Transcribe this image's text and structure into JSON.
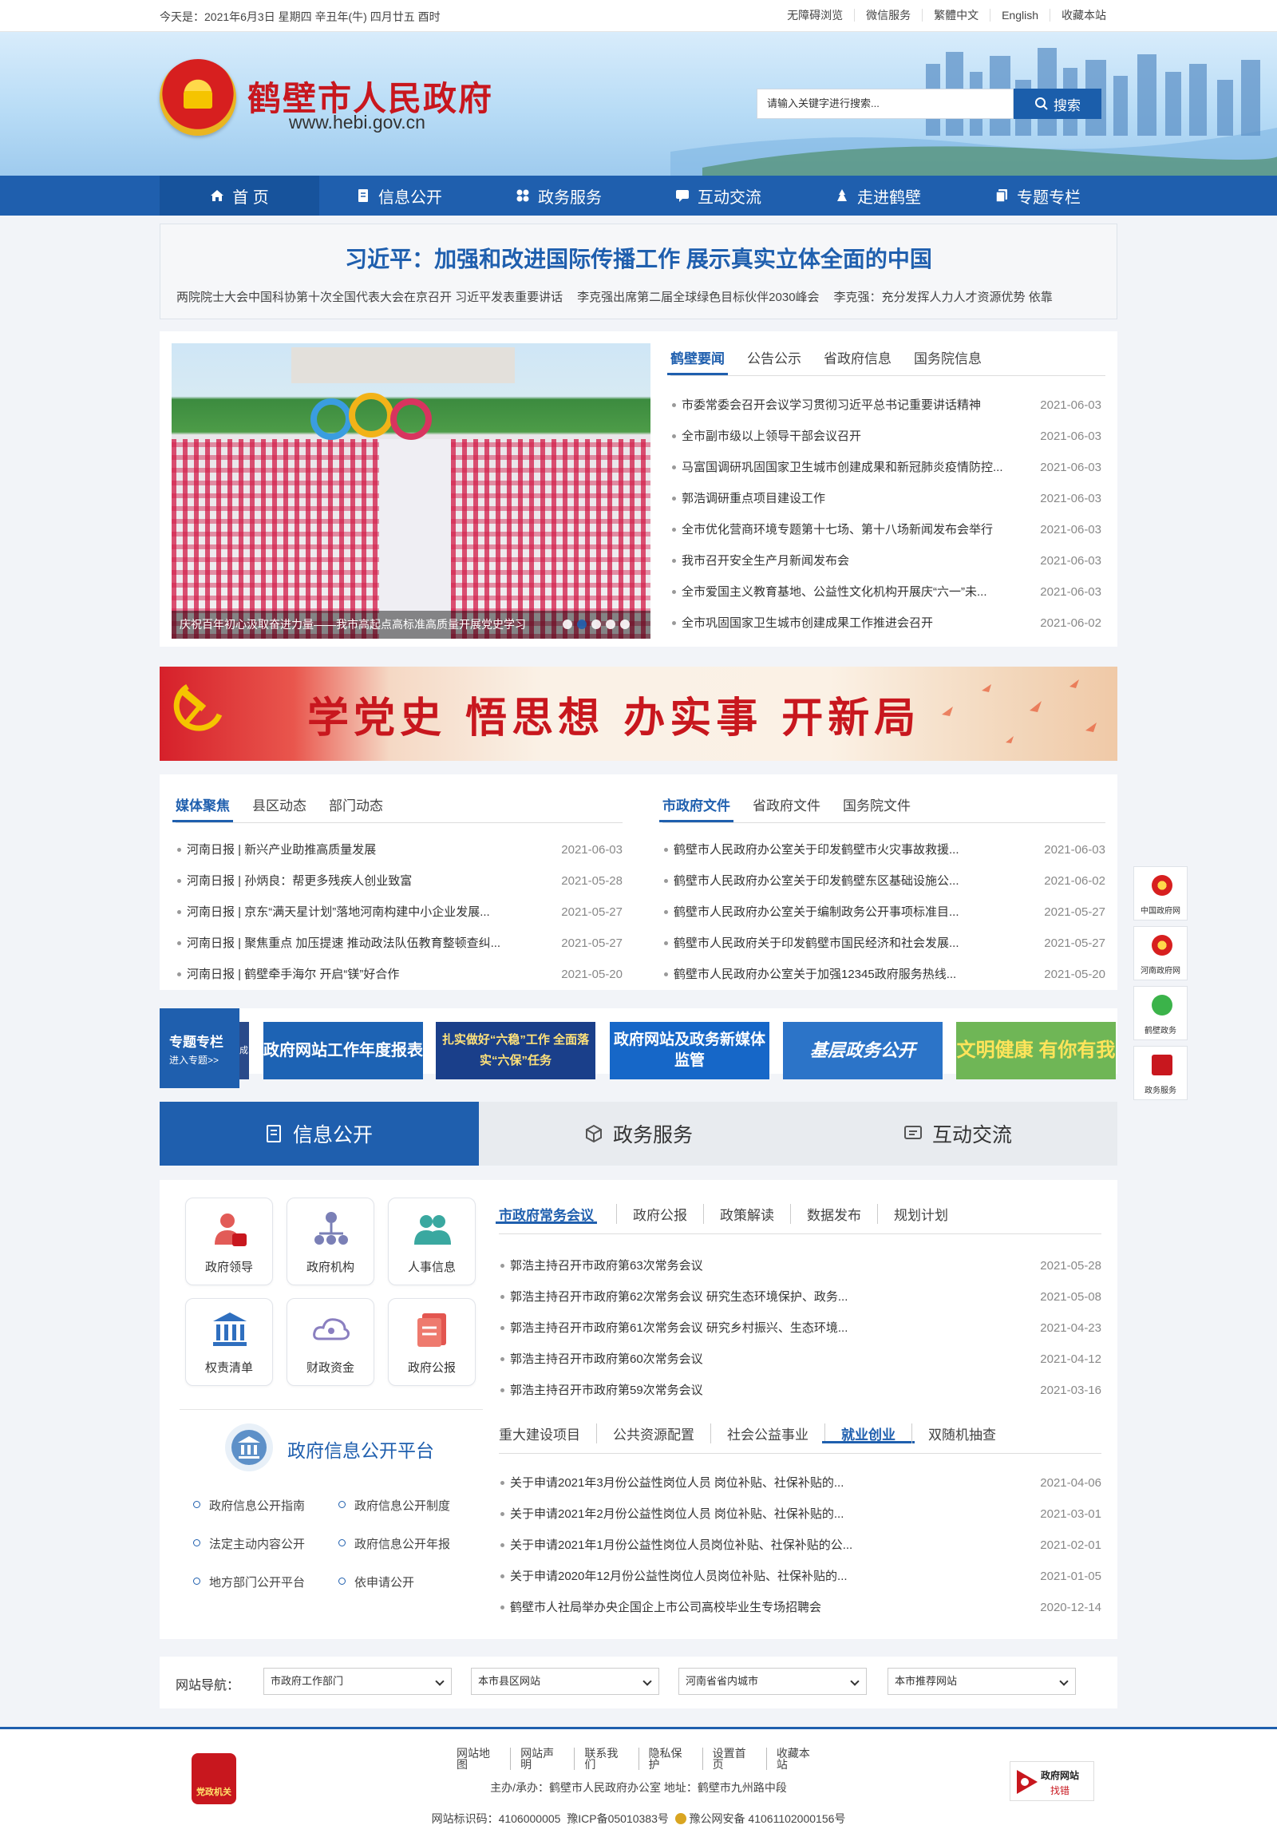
{
  "topbar": {
    "date": "今天是：2021年6月3日 星期四 辛丑年(牛) 四月廿五 酉时",
    "links": [
      "无障碍浏览",
      "微信服务",
      "繁體中文",
      "English",
      "收藏本站"
    ]
  },
  "header": {
    "title": "鹤壁市人民政府",
    "url": "www.hebi.gov.cn",
    "search_placeholder": "请输入关键字进行搜索...",
    "search_button": "搜索"
  },
  "nav": [
    "首 页",
    "信息公开",
    "政务服务",
    "互动交流",
    "走进鹤壁",
    "专题专栏"
  ],
  "headline": {
    "title": "习近平：加强和改进国际传播工作 展示真实立体全面的中国",
    "subs": [
      "两院院士大会中国科协第十次全国代表大会在京召开 习近平发表重要讲话",
      "李克强出席第二届全球绿色目标伙伴2030峰会",
      "李克强：充分发挥人力人才资源优势 依靠"
    ]
  },
  "slide": {
    "caption": "庆祝百年初心汲取奋进力量——我市高起点高标准高质量开展党史学习"
  },
  "news": {
    "tabs": [
      "鹤壁要闻",
      "公告公示",
      "省政府信息",
      "国务院信息"
    ],
    "items": [
      {
        "title": "市委常委会召开会议学习贯彻习近平总书记重要讲话精神",
        "date": "2021-06-03"
      },
      {
        "title": "全市副市级以上领导干部会议召开",
        "date": "2021-06-03"
      },
      {
        "title": "马富国调研巩固国家卫生城市创建成果和新冠肺炎疫情防控...",
        "date": "2021-06-03"
      },
      {
        "title": "郭浩调研重点项目建设工作",
        "date": "2021-06-03"
      },
      {
        "title": "全市优化营商环境专题第十七场、第十八场新闻发布会举行",
        "date": "2021-06-03"
      },
      {
        "title": "我市召开安全生产月新闻发布会",
        "date": "2021-06-03"
      },
      {
        "title": "全市爱国主义教育基地、公益性文化机构开展庆“六一”未...",
        "date": "2021-06-03"
      },
      {
        "title": "全市巩固国家卫生城市创建成果工作推进会召开",
        "date": "2021-06-02"
      }
    ]
  },
  "banner": {
    "text": "学党史 悟思想 办实事 开新局"
  },
  "media": {
    "tabs": [
      "媒体聚焦",
      "县区动态",
      "部门动态"
    ],
    "items": [
      {
        "title": "河南日报 | 新兴产业助推高质量发展",
        "date": "2021-06-03"
      },
      {
        "title": "河南日报 | 孙炳良：帮更多残疾人创业致富",
        "date": "2021-05-28"
      },
      {
        "title": "河南日报 | 京东“满天星计划”落地河南构建中小企业发展...",
        "date": "2021-05-27"
      },
      {
        "title": "河南日报 | 聚焦重点 加压提速 推动政法队伍教育整顿查纠...",
        "date": "2021-05-27"
      },
      {
        "title": "河南日报 | 鹤壁牵手海尔 开启“镁”好合作",
        "date": "2021-05-20"
      }
    ]
  },
  "files": {
    "tabs": [
      "市政府文件",
      "省政府文件",
      "国务院文件"
    ],
    "items": [
      {
        "title": "鹤壁市人民政府办公室关于印发鹤壁市火灾事故救援...",
        "date": "2021-06-03"
      },
      {
        "title": "鹤壁市人民政府办公室关于印发鹤壁东区基础设施公...",
        "date": "2021-06-02"
      },
      {
        "title": "鹤壁市人民政府办公室关于编制政务公开事项标准目...",
        "date": "2021-05-27"
      },
      {
        "title": "鹤壁市人民政府关于印发鹤壁市国民经济和社会发展...",
        "date": "2021-05-27"
      },
      {
        "title": "鹤壁市人民政府办公室关于加强12345政府服务热线...",
        "date": "2021-05-20"
      }
    ]
  },
  "special": {
    "label": "专题专栏",
    "enter": "进入专题>>",
    "edge": "成",
    "items": [
      "政府网站工作年度报表",
      "扎实做好“六稳”工作 全面落实“六保”任务",
      "政府网站及政务新媒体监管",
      "基层政务公开",
      "文明健康 有你有我"
    ]
  },
  "bigtabs": [
    "信息公开",
    "政务服务",
    "互动交流"
  ],
  "tiles": [
    "政府领导",
    "政府机构",
    "人事信息",
    "权责清单",
    "财政资金",
    "政府公报"
  ],
  "platform": {
    "title": "政府信息公开平台",
    "links": [
      "政府信息公开指南",
      "政府信息公开制度",
      "法定主动内容公开",
      "政府信息公开年报",
      "地方部门公开平台",
      "依申请公开"
    ]
  },
  "meetings": {
    "tabs": [
      "市政府常务会议",
      "政府公报",
      "政策解读",
      "数据发布",
      "规划计划"
    ],
    "items": [
      {
        "title": "郭浩主持召开市政府第63次常务会议",
        "date": "2021-05-28"
      },
      {
        "title": "郭浩主持召开市政府第62次常务会议 研究生态环境保护、政务...",
        "date": "2021-05-08"
      },
      {
        "title": "郭浩主持召开市政府第61次常务会议 研究乡村振兴、生态环境...",
        "date": "2021-04-23"
      },
      {
        "title": "郭浩主持召开市政府第60次常务会议",
        "date": "2021-04-12"
      },
      {
        "title": "郭浩主持召开市政府第59次常务会议",
        "date": "2021-03-16"
      }
    ]
  },
  "jobs": {
    "tabs": [
      "重大建设项目",
      "公共资源配置",
      "社会公益事业",
      "就业创业",
      "双随机抽查"
    ],
    "items": [
      {
        "title": "关于申请2021年3月份公益性岗位人员 岗位补贴、社保补贴的...",
        "date": "2021-04-06"
      },
      {
        "title": "关于申请2021年2月份公益性岗位人员 岗位补贴、社保补贴的...",
        "date": "2021-03-01"
      },
      {
        "title": "关于申请2021年1月份公益性岗位人员岗位补贴、社保补贴的公...",
        "date": "2021-02-01"
      },
      {
        "title": "关于申请2020年12月份公益性岗位人员岗位补贴、社保补贴的...",
        "date": "2021-01-05"
      },
      {
        "title": "鹤壁市人社局举办央企国企上市公司高校毕业生专场招聘会",
        "date": "2020-12-14"
      }
    ]
  },
  "sitenav": {
    "label": "网站导航：",
    "selects": [
      "市政府工作部门",
      "本市县区网站",
      "河南省省内城市",
      "本市推荐网站"
    ]
  },
  "side": [
    "中国政府网",
    "河南政府网",
    "鹤壁政务",
    "政务服务"
  ],
  "footer": {
    "links": [
      "网站地图",
      "网站声明",
      "联系我们",
      "隐私保护",
      "设置首页",
      "收藏本站"
    ],
    "sponsor": "主办/承办：鹤壁市人民政府办公室 地址：鹤壁市九州路中段",
    "site_code": "网站标识码：4106000005",
    "icp": "豫ICP备05010383号",
    "police": "豫公网安备 41061102000156号",
    "badge": "党政机关",
    "jiucuo_title": "政府网站",
    "jiucuo_sub": "找错"
  },
  "colors": {
    "primary": "#1f5fae",
    "brand_red": "#c8171e"
  }
}
